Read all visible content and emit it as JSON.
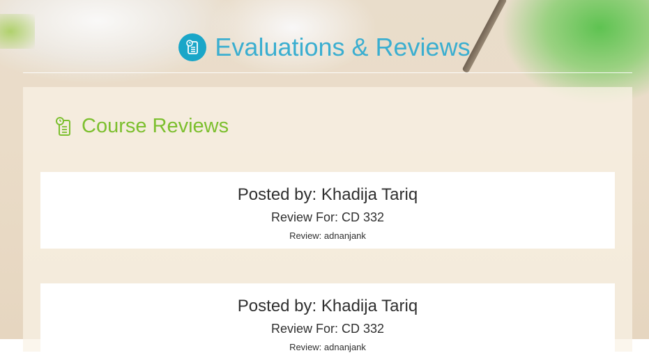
{
  "header": {
    "title": "Evaluations & Reviews",
    "icon": "clipboard-clock-icon",
    "accent_color": "#3aaed0"
  },
  "section": {
    "title": "Course Reviews",
    "icon": "clipboard-clock-icon",
    "color": "#7cbf2e"
  },
  "reviews": [
    {
      "posted_by": "Posted by: Khadija Tariq",
      "review_for": "Review For: CD 332",
      "review": "Review: adnanjank"
    },
    {
      "posted_by": "Posted by: Khadija Tariq",
      "review_for": "Review For: CD 332",
      "review": "Review: adnanjank"
    }
  ]
}
